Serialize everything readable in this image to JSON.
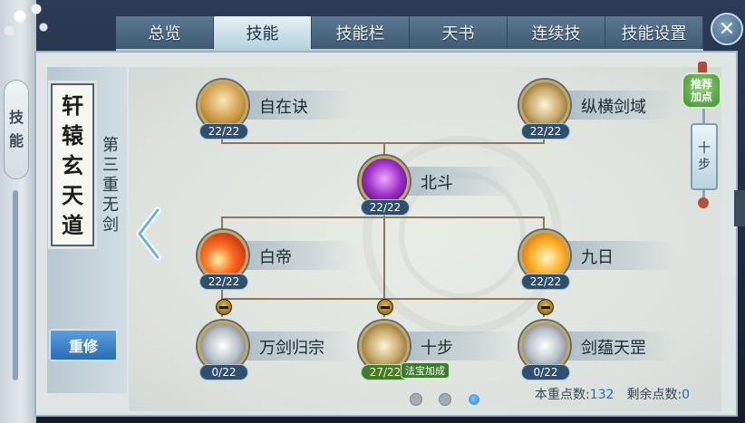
{
  "tabs": [
    {
      "label": "总览",
      "active": false
    },
    {
      "label": "技能",
      "active": true
    },
    {
      "label": "技能栏",
      "active": false
    },
    {
      "label": "天书",
      "active": false
    },
    {
      "label": "连续技",
      "active": false
    },
    {
      "label": "技能设置",
      "active": false
    }
  ],
  "close_label": "✕",
  "side_tab": [
    "技",
    "能"
  ],
  "sect_title": [
    "轩",
    "辕",
    "玄",
    "天",
    "道"
  ],
  "tier_label": [
    "第",
    "三",
    "重",
    "无",
    "剑"
  ],
  "reset_label": "重修",
  "recommend": [
    "推荐",
    "加点"
  ],
  "plan_tag": [
    "十",
    "步"
  ],
  "skills": {
    "zizaijue": {
      "name": "自在诀",
      "level": "22/22"
    },
    "zonghengjianyu": {
      "name": "纵横剑域",
      "level": "22/22"
    },
    "beidou": {
      "name": "北斗",
      "level": "22/22"
    },
    "baidi": {
      "name": "白帝",
      "level": "22/22"
    },
    "jiuri": {
      "name": "九日",
      "level": "22/22"
    },
    "wanjianguizong": {
      "name": "万剑归宗",
      "level": "0/22"
    },
    "shibu": {
      "name": "十步",
      "level": "27/22",
      "badge": "法宝加成"
    },
    "jianyuntianzhao": {
      "name": "剑蕴天罡",
      "level": "0/22"
    }
  },
  "stats": {
    "tier_points_label": "本重点数:",
    "tier_points_value": "132",
    "remaining_label": "剩余点数:",
    "remaining_value": "0"
  },
  "pager": {
    "count": 3,
    "active_index": 2
  }
}
